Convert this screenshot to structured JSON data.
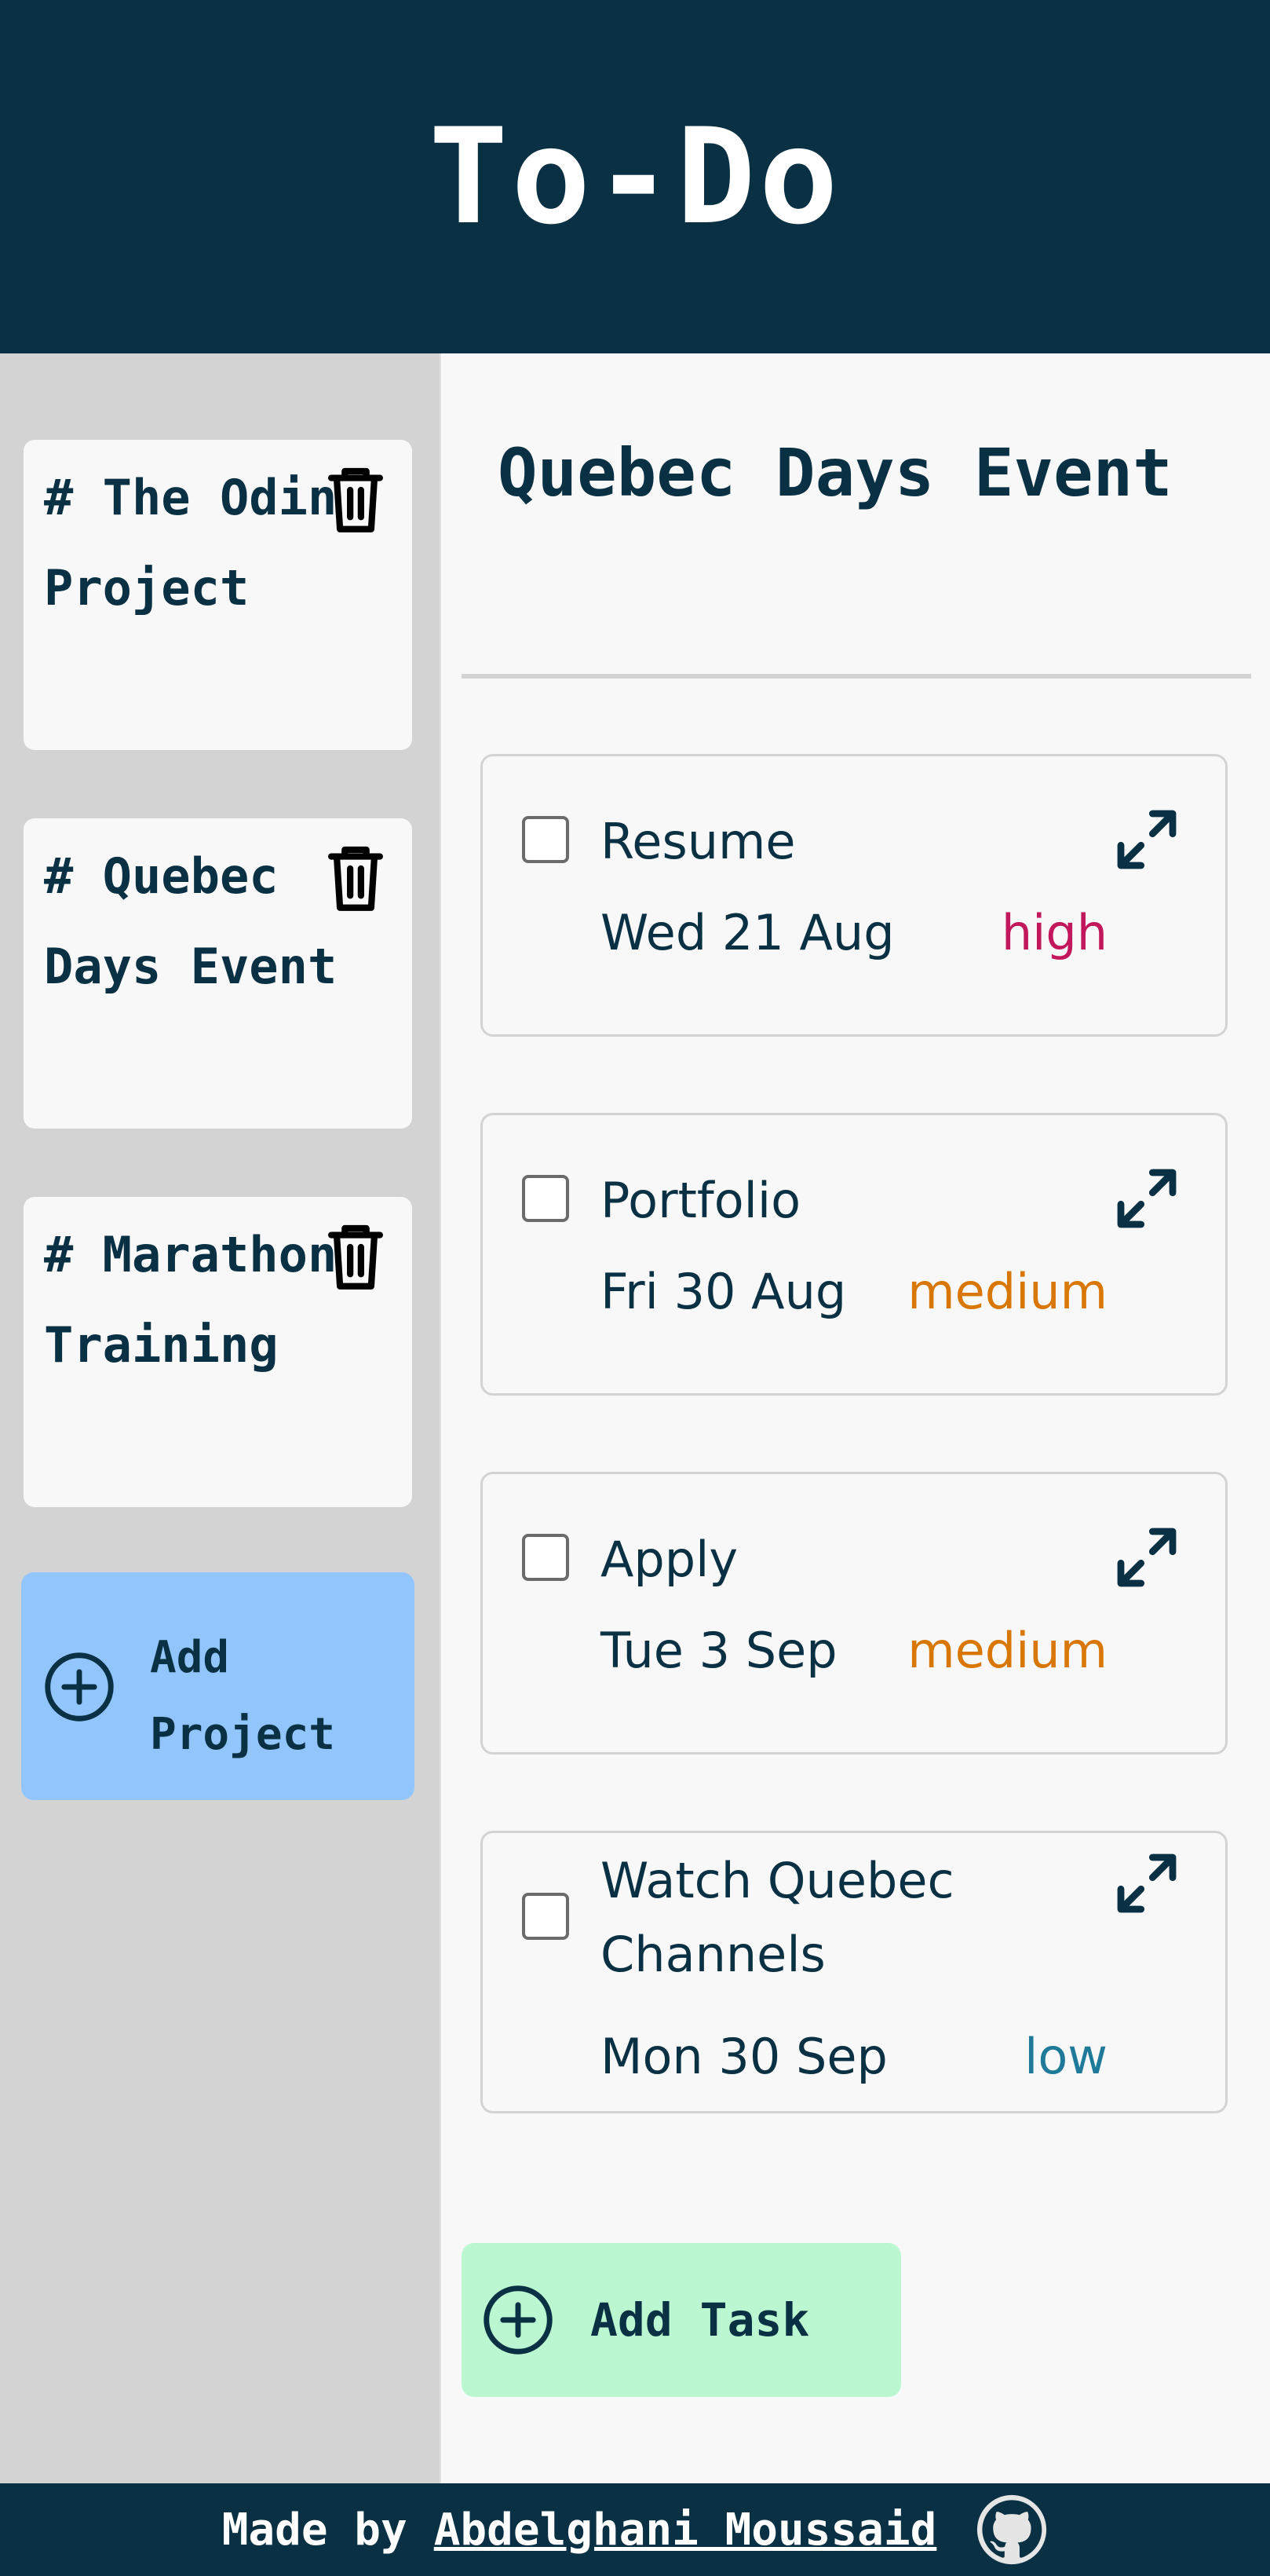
{
  "app": {
    "title": "To-Do"
  },
  "colors": {
    "header_bg": "#0a3143",
    "text": "#0a3143",
    "sidebar_bg": "#d3d3d3",
    "add_project_bg": "#93c5fd",
    "add_task_bg": "#bbf7d0",
    "priority_high": "#c2185b",
    "priority_medium": "#d97706",
    "priority_low": "#1f7a99"
  },
  "sidebar": {
    "projects": [
      {
        "label": "# The Odin Project",
        "icon": "trash-icon"
      },
      {
        "label": "# Quebec Days Event",
        "icon": "trash-icon"
      },
      {
        "label": "# Marathon Training",
        "icon": "trash-icon"
      }
    ],
    "add_project": {
      "label": "Add Project",
      "icon": "plus-circle-icon"
    }
  },
  "main": {
    "project_title": "Quebec Days Event",
    "tasks": [
      {
        "name": "Resume",
        "date": "Wed 21 Aug",
        "priority": "high",
        "completed": false,
        "icon": "expand-icon"
      },
      {
        "name": "Portfolio",
        "date": "Fri 30 Aug",
        "priority": "medium",
        "completed": false,
        "icon": "expand-icon"
      },
      {
        "name": "Apply",
        "date": "Tue 3 Sep",
        "priority": "medium",
        "completed": false,
        "icon": "expand-icon"
      },
      {
        "name": "Watch Quebec Channels",
        "date": "Mon 30 Sep",
        "priority": "low",
        "completed": false,
        "icon": "expand-icon"
      }
    ],
    "add_task": {
      "label": "Add Task",
      "icon": "plus-circle-icon"
    }
  },
  "footer": {
    "made_by": "Made by",
    "author": "Abdelghani Moussaid",
    "icon": "github-icon"
  }
}
